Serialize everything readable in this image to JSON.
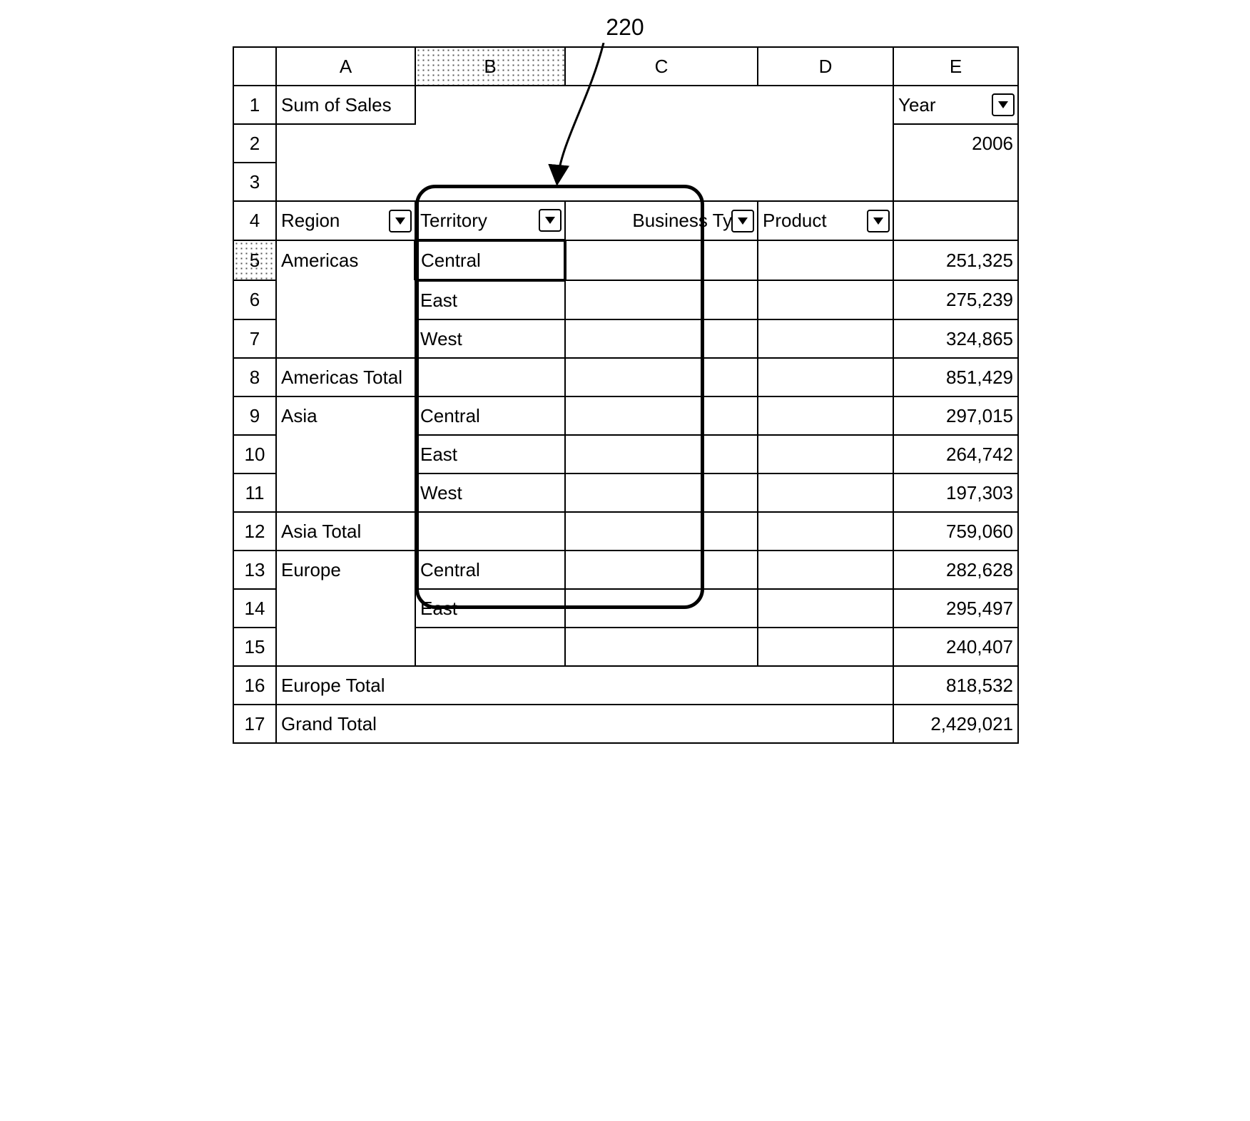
{
  "callout": "220",
  "columns": {
    "h": "",
    "a": "A",
    "b": "B",
    "c": "C",
    "d": "D",
    "e": "E"
  },
  "rowNums": [
    "1",
    "2",
    "3",
    "4",
    "5",
    "6",
    "7",
    "8",
    "9",
    "10",
    "11",
    "12",
    "13",
    "14",
    "15",
    "16",
    "17"
  ],
  "row1": {
    "a": "Sum of Sales",
    "e_label": "Year"
  },
  "row2": {
    "e": "2006"
  },
  "row4": {
    "a": "Region",
    "b": "Territory",
    "c": "Business Type",
    "d": "Product"
  },
  "pivot": {
    "americas": {
      "label": "Americas",
      "central": "Central",
      "east": "East",
      "west": "West",
      "v5": "251,325",
      "v6": "275,239",
      "v7": "324,865",
      "total_label": "Americas Total",
      "total": "851,429"
    },
    "asia": {
      "label": "Asia",
      "central": "Central",
      "east": "East",
      "west": "West",
      "v9": "297,015",
      "v10": "264,742",
      "v11": "197,303",
      "total_label": "Asia Total",
      "total": "759,060"
    },
    "europe": {
      "label": "Europe",
      "central": "Central",
      "east": "East",
      "v13": "282,628",
      "v14": "295,497",
      "v15": "240,407",
      "total_label": "Europe Total",
      "total": "818,532"
    },
    "grand": {
      "label": "Grand Total",
      "total": "2,429,021"
    }
  },
  "chart_data": {
    "type": "table",
    "title": "Sum of Sales",
    "filter": {
      "Year": 2006
    },
    "row_fields": [
      "Region",
      "Territory",
      "Business Type",
      "Product"
    ],
    "rows": [
      {
        "Region": "Americas",
        "Territory": "Central",
        "value": 251325
      },
      {
        "Region": "Americas",
        "Territory": "East",
        "value": 275239
      },
      {
        "Region": "Americas",
        "Territory": "West",
        "value": 324865
      },
      {
        "Region": "Americas Total",
        "value": 851429
      },
      {
        "Region": "Asia",
        "Territory": "Central",
        "value": 297015
      },
      {
        "Region": "Asia",
        "Territory": "East",
        "value": 264742
      },
      {
        "Region": "Asia",
        "Territory": "West",
        "value": 197303
      },
      {
        "Region": "Asia Total",
        "value": 759060
      },
      {
        "Region": "Europe",
        "Territory": "Central",
        "value": 282628
      },
      {
        "Region": "Europe",
        "Territory": "East",
        "value": 295497
      },
      {
        "Region": "Europe",
        "value": 240407
      },
      {
        "Region": "Europe Total",
        "value": 818532
      },
      {
        "Region": "Grand Total",
        "value": 2429021
      }
    ]
  }
}
